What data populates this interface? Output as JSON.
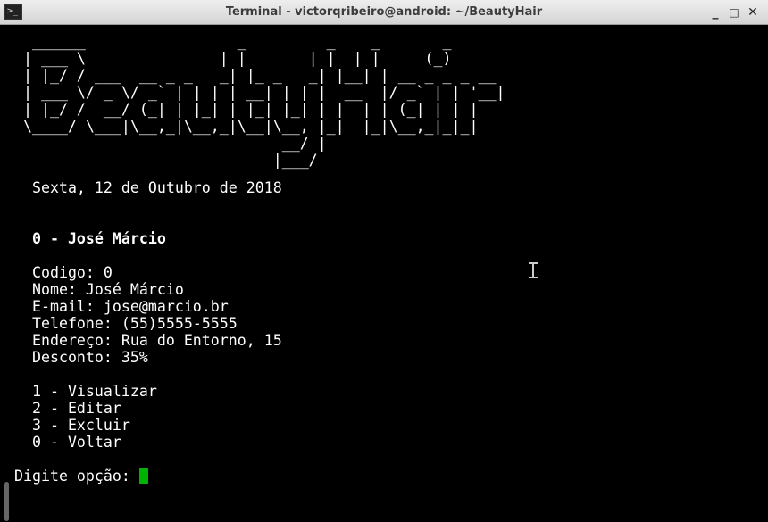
{
  "window": {
    "title": "Terminal - victorqribeiro@android: ~/BeautyHair",
    "controls": {
      "minimize": "_",
      "maximize": "□",
      "close": "✕"
    },
    "icon": "terminal-icon"
  },
  "terminal": {
    "banner": "  ______                 _         _    _       _\n | ___ \\               | |       | |  | |     (_)\n | |_/ / ___  __ _ _   _| |_ _   _| |__| | __ _ _ _ __\n | ___ \\/ _ \\/ _` | | | | __| | | |  __  |/ _` | | '__|\n | |_/ /  __/ (_| | |_| | |_| |_| | |  | | (_| | | |\n \\____/ \\___|\\__,_|\\__,_|\\__|\\__, |_|  |_|\\__,_|_|_|\n                              __/ |\n                             |___/",
    "date": "Sexta, 12 de Outubro de 2018",
    "client_header": "0 - José Márcio",
    "details": [
      "Codigo: 0",
      "Nome: José Márcio",
      "E-mail: jose@marcio.br",
      "Telefone: (55)5555-5555",
      "Endereço: Rua do Entorno, 15",
      "Desconto: 35%"
    ],
    "menu": [
      "1 - Visualizar",
      "2 - Editar",
      "3 - Excluir",
      "0 - Voltar"
    ],
    "prompt": "Digite opção: ",
    "cursor_color": "#00b300"
  }
}
